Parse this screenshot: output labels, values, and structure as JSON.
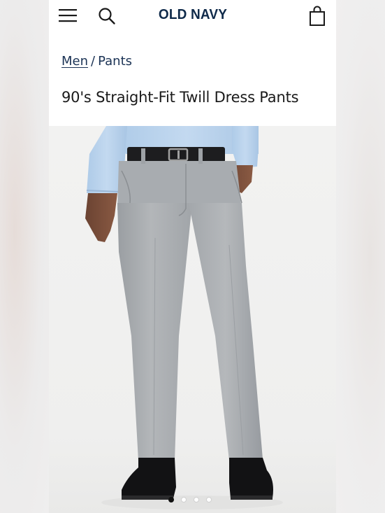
{
  "header": {
    "brand": "OLD NAVY",
    "icons": [
      "menu-icon",
      "search-icon",
      "shopping-bag-icon"
    ]
  },
  "breadcrumb": {
    "parent": "Men",
    "separator": "/",
    "current": "Pants"
  },
  "product": {
    "title": "90's Straight-Fit Twill Dress Pants"
  },
  "gallery": {
    "image_count": 4,
    "active_index": 0
  },
  "colors": {
    "brand_navy": "#0f2a4a",
    "link": "#1b3355",
    "pants_gray": "#a8acb0",
    "shirt_blue": "#bcd4ec"
  }
}
